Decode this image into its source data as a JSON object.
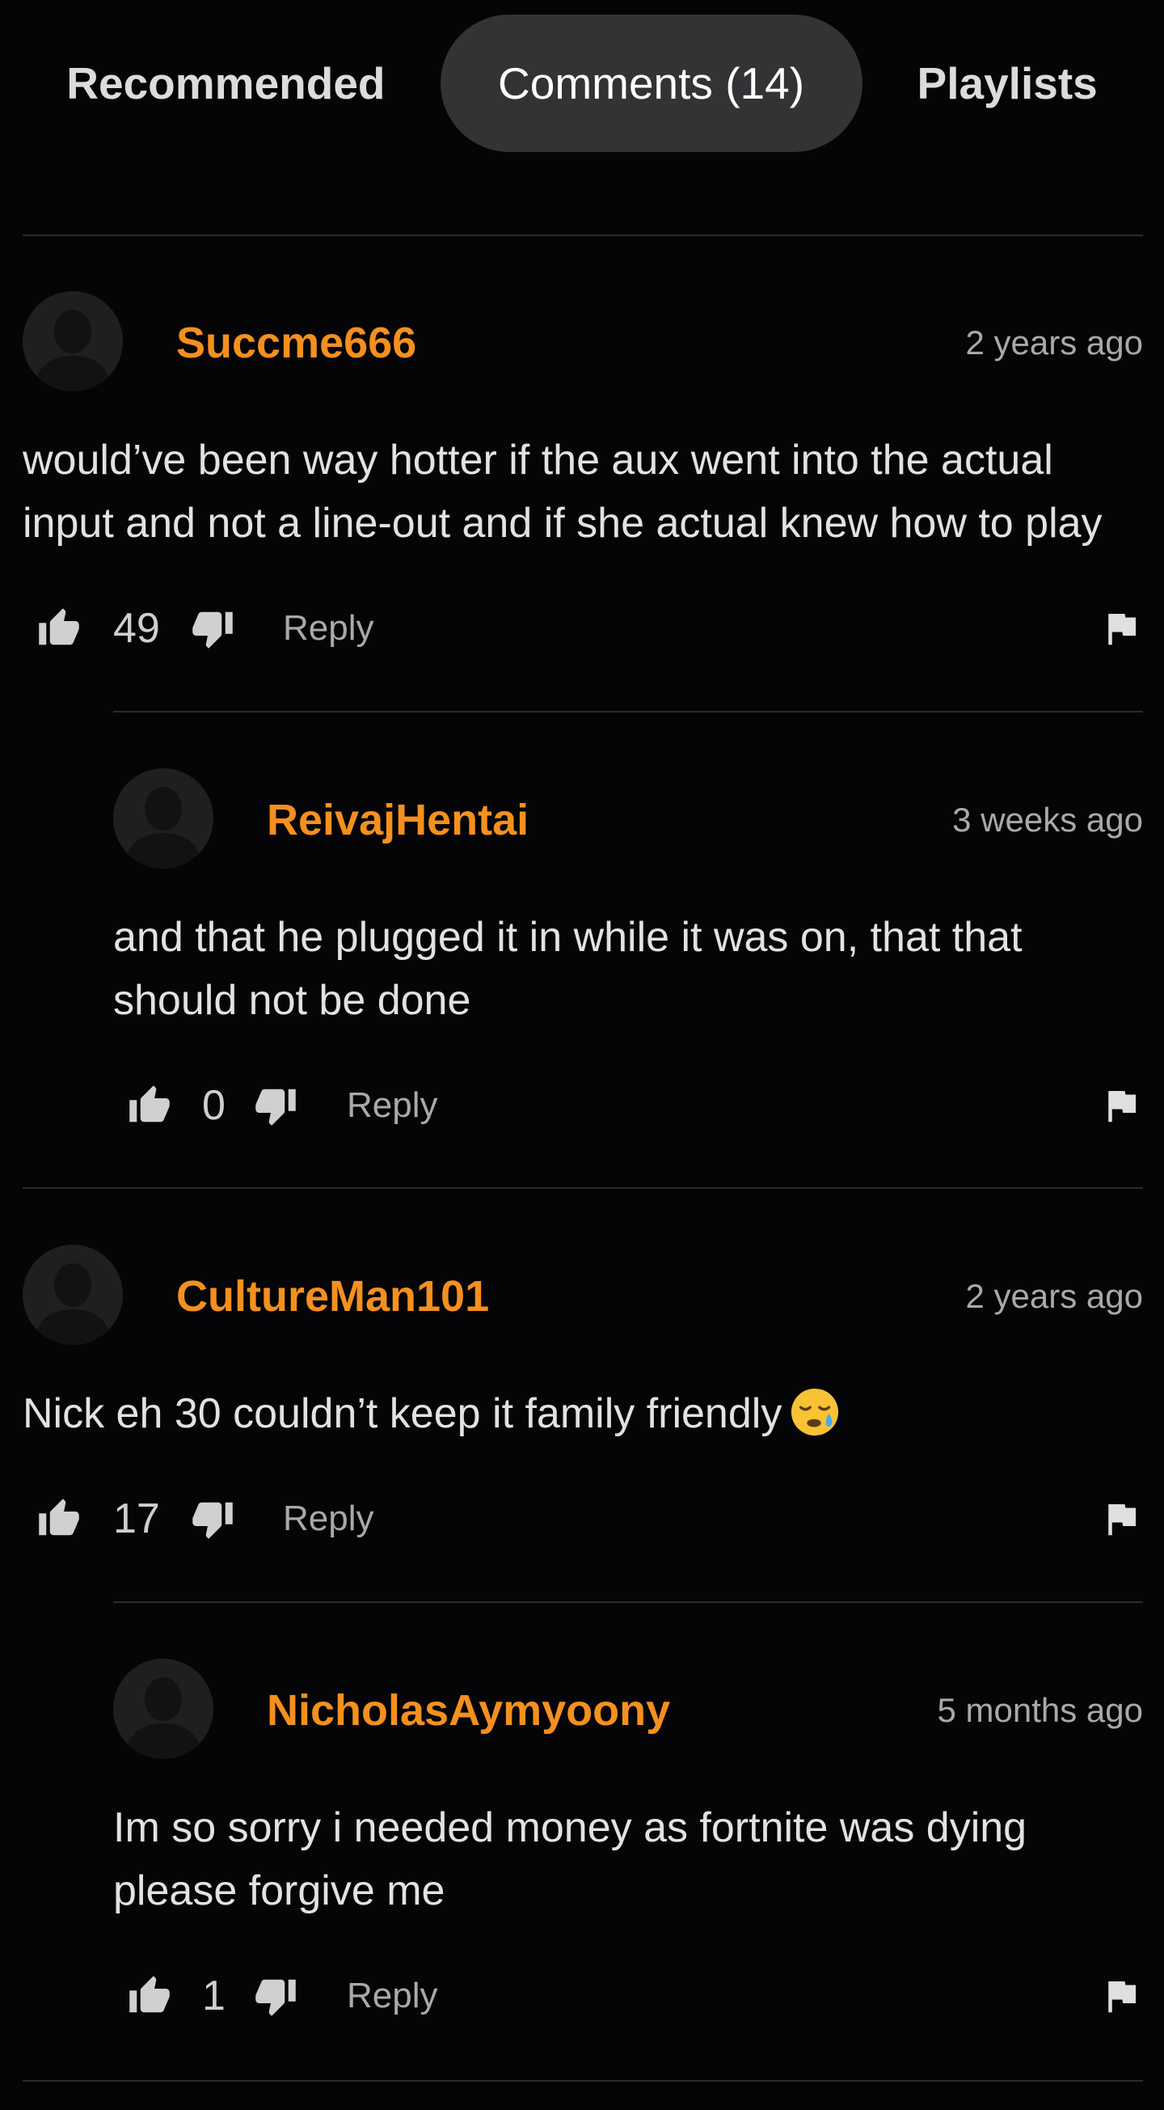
{
  "tabs": [
    {
      "label": "Recommended"
    },
    {
      "label": "Comments (14)"
    },
    {
      "label": "Playlists"
    }
  ],
  "colors": {
    "username": "#f4901e",
    "background": "#050507",
    "active_tab": "#333336"
  },
  "comments": [
    {
      "username": "Succme666",
      "time": "2 years ago",
      "text": "would’ve been way hotter if the aux went into the actual input and not a line-out and if she actual knew how to play",
      "likes": "49",
      "reply_label": "Reply"
    },
    {
      "username": "ReivajHentai",
      "time": "3 weeks ago",
      "text": "and that he plugged it in while it was on, that that should not be done",
      "likes": "0",
      "reply_label": "Reply"
    },
    {
      "username": "CultureMan101",
      "time": "2 years ago",
      "text": "Nick eh 30 couldn’t keep it family friendly",
      "emoji": "sleepy-face-emoji",
      "likes": "17",
      "reply_label": "Reply"
    },
    {
      "username": "NicholasAymyoony",
      "time": "5 months ago",
      "text": "Im so sorry i needed money as fortnite was dying please forgive me",
      "likes": "1",
      "reply_label": "Reply"
    }
  ],
  "icons": [
    "thumbs-up-icon",
    "thumbs-down-icon",
    "flag-icon",
    "avatar-placeholder-icon"
  ]
}
